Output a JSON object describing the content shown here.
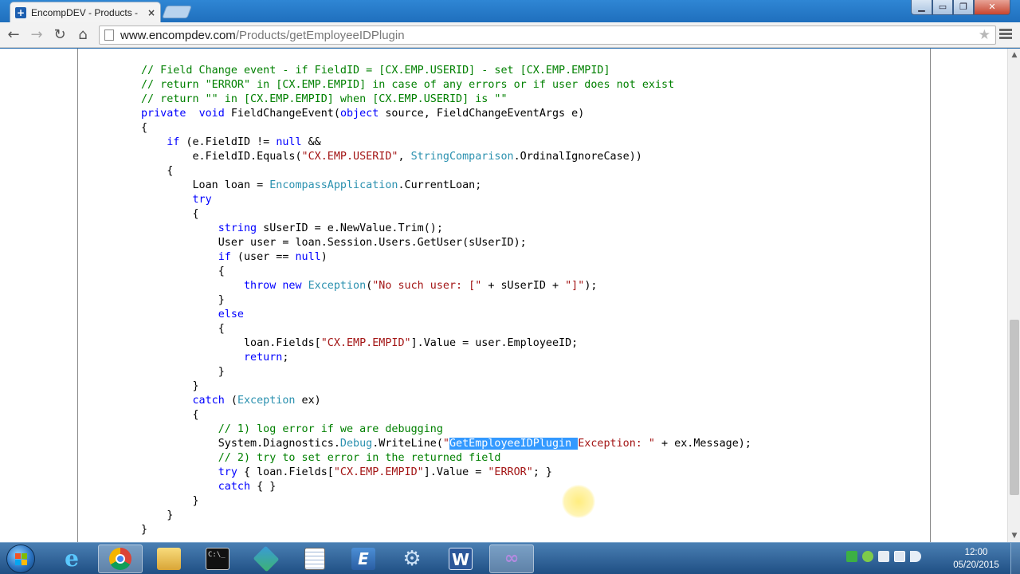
{
  "browser": {
    "tab_title": "EncompDEV - Products -  ",
    "tab_close": "×",
    "url_host": "www.encompdev.com",
    "url_path": "/Products/getEmployeeIDPlugin",
    "window_controls": {
      "minimize": "▁",
      "maximize": "▭",
      "restore": "❐",
      "close": "✕"
    },
    "nav_icons": {
      "back": "←",
      "forward": "→",
      "reload": "↻",
      "home": "⌂",
      "star": "★"
    }
  },
  "code": {
    "highlighted_text": "GetEmployeeIDPlugin "
  },
  "scrollbar": {
    "up": "▲",
    "down": "▼"
  },
  "taskbar": {
    "clock_time": "12:00",
    "clock_date": "05/20/2015",
    "pinned": [
      "internet-explorer-icon",
      "chrome-icon",
      "file-explorer-icon",
      "cmd-prompt-icon",
      "puzzle-icon",
      "notepad-icon",
      "editor-e-icon",
      "settings-gear-icon",
      "word-icon",
      "visual-studio-icon"
    ]
  }
}
